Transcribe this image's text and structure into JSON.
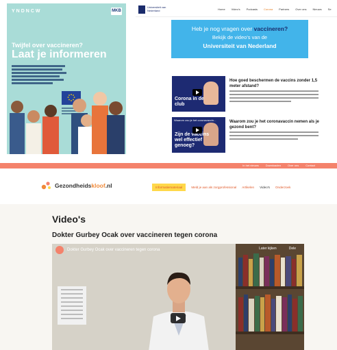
{
  "poster": {
    "logo": "YNDNCW",
    "badge": "MKB",
    "question": "Twijfel over vaccineren?",
    "headline": "Laat je informeren"
  },
  "university": {
    "logo_text": "Universiteit van Nederland",
    "nav": [
      "Home",
      "Video's",
      "Podcasts",
      "Corona",
      "Partners",
      "Over ons",
      "Nieuws",
      "Se"
    ],
    "nav_active_index": 3,
    "banner": {
      "line1_prefix": "Heb je nog vragen over ",
      "line1_bold": "vaccineren?",
      "line2": "Bekijk de video's van de",
      "line3": "Universiteit van Nederland"
    },
    "cards": [
      {
        "caption": "Corona in de club",
        "title": "Hoe goed beschermen de vaccins zonder 1,5 meter afstand?"
      },
      {
        "caption": "Zijn de vaccins wel effectief genoeg?",
        "thumb_title": "Waarom zou je het coronavaccin...",
        "title": "Waarom zou je het coronavaccin nemen als je gezond bent?"
      }
    ]
  },
  "gezondheidskloof": {
    "top_links": [
      "In het nieuws",
      "Downloaden",
      "Over ons",
      "Contact"
    ],
    "brand_prefix": "Gezondheids",
    "brand_highlight": "kloof",
    "brand_suffix": ".nl",
    "menu": [
      "Informatiemateriaal",
      "Meld je aan als zorgprofessional",
      "Artikelen",
      "Video's",
      "Onderzoek"
    ],
    "menu_highlight_index": 0,
    "page_title": "Video's",
    "video_heading": "Dokter Gurbey Ocak over vaccineren tegen corona",
    "video": {
      "title": "Dokter Gurbey Ocak over vaccineren tegen corona",
      "controls": [
        "Later kijken",
        "Dele"
      ]
    }
  },
  "colors": {
    "poster_bg": "#a9dcd7",
    "uni_banner": "#42b4ea",
    "gk_strip": "#f4826b",
    "gk_menu_highlight": "#ffd84a"
  }
}
